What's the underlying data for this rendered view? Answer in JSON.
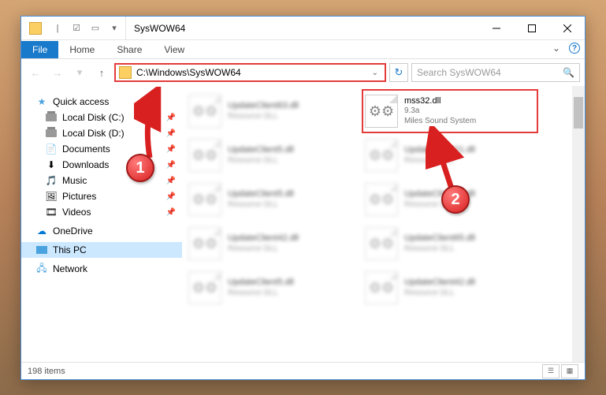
{
  "window": {
    "title": "SysWOW64"
  },
  "ribbon": {
    "tabs": {
      "file": "File",
      "home": "Home",
      "share": "Share",
      "view": "View"
    }
  },
  "nav": {
    "address": "C:\\Windows\\SysWOW64",
    "search_placeholder": "Search SysWOW64"
  },
  "sidebar": {
    "quick_access": "Quick access",
    "items": [
      {
        "label": "Local Disk (C:)"
      },
      {
        "label": "Local Disk (D:)"
      },
      {
        "label": "Documents"
      },
      {
        "label": "Downloads"
      },
      {
        "label": "Music"
      },
      {
        "label": "Pictures"
      },
      {
        "label": "Videos"
      }
    ],
    "onedrive": "OneDrive",
    "thispc": "This PC",
    "network": "Network"
  },
  "files": [
    {
      "name": "UpdateClient63.dll",
      "meta1": "",
      "meta2": "Resource DLL",
      "blurred": true
    },
    {
      "name": "mss32.dll",
      "meta1": "9.3a",
      "meta2": "Miles Sound System",
      "highlighted": true
    },
    {
      "name": "UpdateClient5.dll",
      "meta1": "",
      "meta2": "Resource DLL",
      "blurred": true
    },
    {
      "name": "UpdateClient21.dll",
      "meta1": "",
      "meta2": "Resource DLL",
      "blurred": true
    },
    {
      "name": "UpdateClient5.dll",
      "meta1": "",
      "meta2": "Resource DLL",
      "blurred": true
    },
    {
      "name": "UpdateClient19.dll",
      "meta1": "",
      "meta2": "Resource DLL",
      "blurred": true
    },
    {
      "name": "UpdateClient42.dll",
      "meta1": "",
      "meta2": "Resource DLL",
      "blurred": true
    },
    {
      "name": "UpdateClient65.dll",
      "meta1": "",
      "meta2": "Resource DLL",
      "blurred": true
    },
    {
      "name": "UpdateClient5.dll",
      "meta1": "",
      "meta2": "Resource DLL",
      "blurred": true
    },
    {
      "name": "UpdateClient42.dll",
      "meta1": "",
      "meta2": "Resource DLL",
      "blurred": true
    }
  ],
  "status": {
    "count": "198 items"
  },
  "callouts": {
    "one": "1",
    "two": "2"
  }
}
